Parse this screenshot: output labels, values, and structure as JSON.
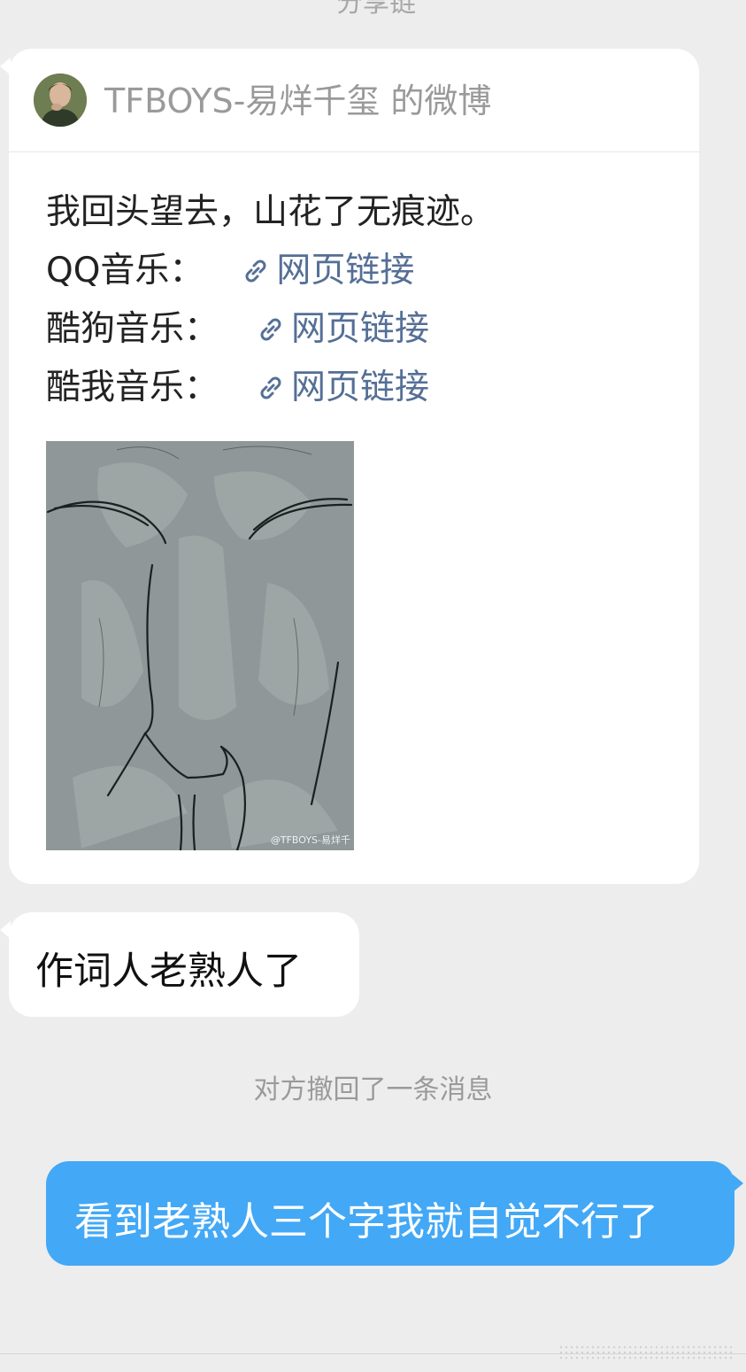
{
  "top_partial_text": "分享链",
  "shared_post": {
    "source_title": "TFBOYS-易烊千玺 的微博",
    "lines": [
      {
        "text": "我回头望去，山花了无痕迹。",
        "link": ""
      },
      {
        "text": "QQ音乐：",
        "link": "网页链接"
      },
      {
        "text": "酷狗音乐：",
        "link": "网页链接"
      },
      {
        "text": "酷我音乐：",
        "link": "网页链接"
      }
    ],
    "image_watermark": "@TFBOYS-易烊千"
  },
  "messages": {
    "received": "作词人老熟人了",
    "system_notice": "对方撤回了一条消息",
    "sent": "看到老熟人三个字我就自觉不行了"
  },
  "colors": {
    "background": "#ededed",
    "sent_bubble": "#43a8f6",
    "link": "#556f96"
  }
}
